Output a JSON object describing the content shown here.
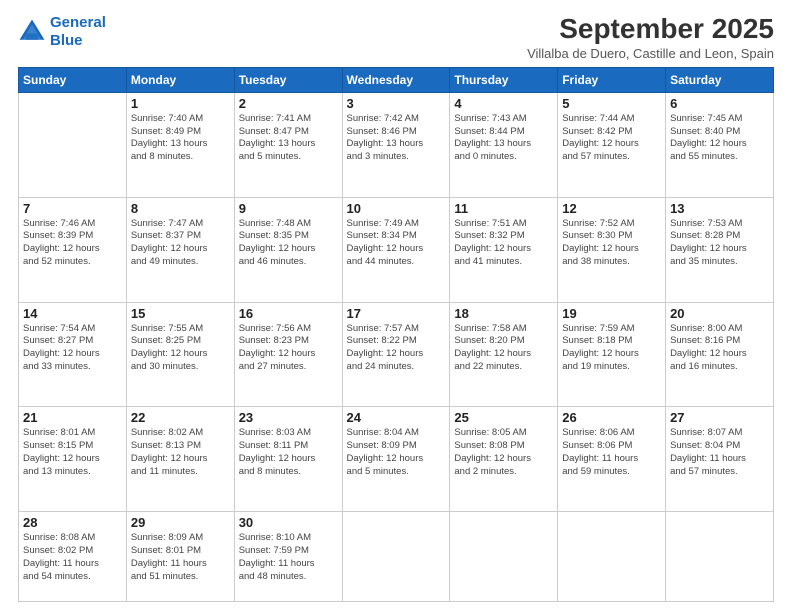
{
  "logo": {
    "line1": "General",
    "line2": "Blue"
  },
  "header": {
    "month": "September 2025",
    "location": "Villalba de Duero, Castille and Leon, Spain"
  },
  "days": [
    "Sunday",
    "Monday",
    "Tuesday",
    "Wednesday",
    "Thursday",
    "Friday",
    "Saturday"
  ],
  "weeks": [
    [
      {
        "day": "",
        "content": ""
      },
      {
        "day": "1",
        "content": "Sunrise: 7:40 AM\nSunset: 8:49 PM\nDaylight: 13 hours\nand 8 minutes."
      },
      {
        "day": "2",
        "content": "Sunrise: 7:41 AM\nSunset: 8:47 PM\nDaylight: 13 hours\nand 5 minutes."
      },
      {
        "day": "3",
        "content": "Sunrise: 7:42 AM\nSunset: 8:46 PM\nDaylight: 13 hours\nand 3 minutes."
      },
      {
        "day": "4",
        "content": "Sunrise: 7:43 AM\nSunset: 8:44 PM\nDaylight: 13 hours\nand 0 minutes."
      },
      {
        "day": "5",
        "content": "Sunrise: 7:44 AM\nSunset: 8:42 PM\nDaylight: 12 hours\nand 57 minutes."
      },
      {
        "day": "6",
        "content": "Sunrise: 7:45 AM\nSunset: 8:40 PM\nDaylight: 12 hours\nand 55 minutes."
      }
    ],
    [
      {
        "day": "7",
        "content": "Sunrise: 7:46 AM\nSunset: 8:39 PM\nDaylight: 12 hours\nand 52 minutes."
      },
      {
        "day": "8",
        "content": "Sunrise: 7:47 AM\nSunset: 8:37 PM\nDaylight: 12 hours\nand 49 minutes."
      },
      {
        "day": "9",
        "content": "Sunrise: 7:48 AM\nSunset: 8:35 PM\nDaylight: 12 hours\nand 46 minutes."
      },
      {
        "day": "10",
        "content": "Sunrise: 7:49 AM\nSunset: 8:34 PM\nDaylight: 12 hours\nand 44 minutes."
      },
      {
        "day": "11",
        "content": "Sunrise: 7:51 AM\nSunset: 8:32 PM\nDaylight: 12 hours\nand 41 minutes."
      },
      {
        "day": "12",
        "content": "Sunrise: 7:52 AM\nSunset: 8:30 PM\nDaylight: 12 hours\nand 38 minutes."
      },
      {
        "day": "13",
        "content": "Sunrise: 7:53 AM\nSunset: 8:28 PM\nDaylight: 12 hours\nand 35 minutes."
      }
    ],
    [
      {
        "day": "14",
        "content": "Sunrise: 7:54 AM\nSunset: 8:27 PM\nDaylight: 12 hours\nand 33 minutes."
      },
      {
        "day": "15",
        "content": "Sunrise: 7:55 AM\nSunset: 8:25 PM\nDaylight: 12 hours\nand 30 minutes."
      },
      {
        "day": "16",
        "content": "Sunrise: 7:56 AM\nSunset: 8:23 PM\nDaylight: 12 hours\nand 27 minutes."
      },
      {
        "day": "17",
        "content": "Sunrise: 7:57 AM\nSunset: 8:22 PM\nDaylight: 12 hours\nand 24 minutes."
      },
      {
        "day": "18",
        "content": "Sunrise: 7:58 AM\nSunset: 8:20 PM\nDaylight: 12 hours\nand 22 minutes."
      },
      {
        "day": "19",
        "content": "Sunrise: 7:59 AM\nSunset: 8:18 PM\nDaylight: 12 hours\nand 19 minutes."
      },
      {
        "day": "20",
        "content": "Sunrise: 8:00 AM\nSunset: 8:16 PM\nDaylight: 12 hours\nand 16 minutes."
      }
    ],
    [
      {
        "day": "21",
        "content": "Sunrise: 8:01 AM\nSunset: 8:15 PM\nDaylight: 12 hours\nand 13 minutes."
      },
      {
        "day": "22",
        "content": "Sunrise: 8:02 AM\nSunset: 8:13 PM\nDaylight: 12 hours\nand 11 minutes."
      },
      {
        "day": "23",
        "content": "Sunrise: 8:03 AM\nSunset: 8:11 PM\nDaylight: 12 hours\nand 8 minutes."
      },
      {
        "day": "24",
        "content": "Sunrise: 8:04 AM\nSunset: 8:09 PM\nDaylight: 12 hours\nand 5 minutes."
      },
      {
        "day": "25",
        "content": "Sunrise: 8:05 AM\nSunset: 8:08 PM\nDaylight: 12 hours\nand 2 minutes."
      },
      {
        "day": "26",
        "content": "Sunrise: 8:06 AM\nSunset: 8:06 PM\nDaylight: 11 hours\nand 59 minutes."
      },
      {
        "day": "27",
        "content": "Sunrise: 8:07 AM\nSunset: 8:04 PM\nDaylight: 11 hours\nand 57 minutes."
      }
    ],
    [
      {
        "day": "28",
        "content": "Sunrise: 8:08 AM\nSunset: 8:02 PM\nDaylight: 11 hours\nand 54 minutes."
      },
      {
        "day": "29",
        "content": "Sunrise: 8:09 AM\nSunset: 8:01 PM\nDaylight: 11 hours\nand 51 minutes."
      },
      {
        "day": "30",
        "content": "Sunrise: 8:10 AM\nSunset: 7:59 PM\nDaylight: 11 hours\nand 48 minutes."
      },
      {
        "day": "",
        "content": ""
      },
      {
        "day": "",
        "content": ""
      },
      {
        "day": "",
        "content": ""
      },
      {
        "day": "",
        "content": ""
      }
    ]
  ]
}
